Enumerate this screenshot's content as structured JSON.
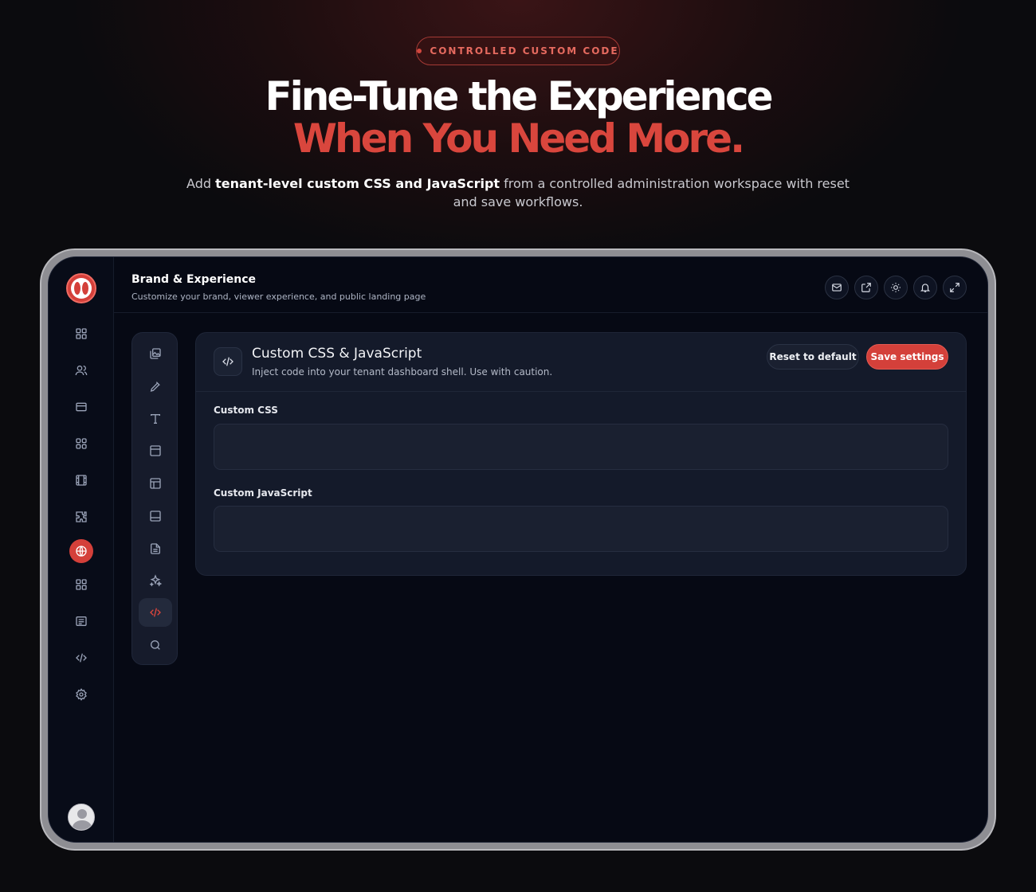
{
  "hero": {
    "badge": "CONTROLLED CUSTOM CODE",
    "title_line1": "Fine-Tune the Experience",
    "title_line2": "When You Need More.",
    "subtitle_pre": "Add ",
    "subtitle_bold": "tenant-level custom CSS and JavaScript",
    "subtitle_post": " from a controlled administration workspace with reset and save workflows."
  },
  "colors": {
    "accent": "#d4403a",
    "background": "#060914",
    "card": "#141a2a"
  },
  "rail": {
    "items": [
      {
        "icon": "dashboard-icon"
      },
      {
        "icon": "users-icon"
      },
      {
        "icon": "card-icon"
      },
      {
        "icon": "apps-icon"
      },
      {
        "icon": "film-icon"
      },
      {
        "icon": "puzzle-icon"
      },
      {
        "icon": "globe-icon",
        "active": true
      },
      {
        "icon": "grid-icon"
      },
      {
        "icon": "list-icon"
      },
      {
        "icon": "code-icon"
      },
      {
        "icon": "settings-icon"
      }
    ]
  },
  "header": {
    "title": "Brand & Experience",
    "subtitle": "Customize your brand, viewer experience, and public landing page",
    "actions": [
      "mail-icon",
      "external-link-icon",
      "sun-icon",
      "bell-icon",
      "expand-icon"
    ]
  },
  "subnav": {
    "items": [
      {
        "icon": "images-icon"
      },
      {
        "icon": "eyedropper-icon"
      },
      {
        "icon": "type-icon"
      },
      {
        "icon": "header-layout-icon"
      },
      {
        "icon": "sidebar-layout-icon"
      },
      {
        "icon": "footer-layout-icon"
      },
      {
        "icon": "document-icon"
      },
      {
        "icon": "sparkles-icon"
      },
      {
        "icon": "code-icon",
        "active": true
      },
      {
        "icon": "search-icon"
      }
    ]
  },
  "panel": {
    "title": "Custom CSS & JavaScript",
    "description": "Inject code into your tenant dashboard shell. Use with caution.",
    "reset_label": "Reset to default",
    "save_label": "Save settings",
    "css_label": "Custom CSS",
    "css_value": "",
    "js_label": "Custom JavaScript",
    "js_value": ""
  }
}
